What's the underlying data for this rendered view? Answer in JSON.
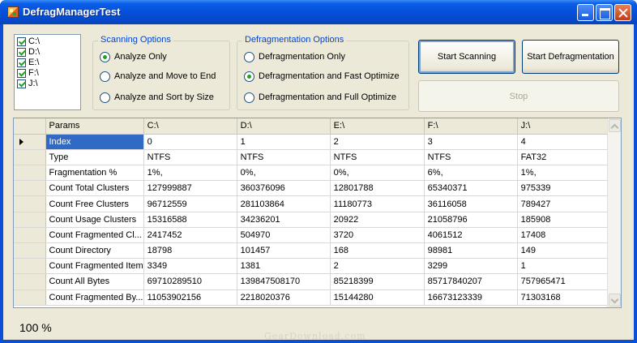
{
  "window": {
    "title": "DefragManagerTest"
  },
  "drives": [
    "C:\\",
    "D:\\",
    "E:\\",
    "F:\\",
    "J:\\"
  ],
  "scanning_options": {
    "title": "Scanning Options",
    "options": [
      "Analyze Only",
      "Analyze and Move to End",
      "Analyze and Sort by Size"
    ],
    "selected": 0
  },
  "defrag_options": {
    "title": "Defragmentation Options",
    "options": [
      "Defragmentation Only",
      "Defragmentation and Fast Optimize",
      "Defragmentation and Full Optimize"
    ],
    "selected": 1
  },
  "buttons": {
    "start_scanning": "Start Scanning",
    "start_defrag": "Start Defragmentation",
    "stop": "Stop"
  },
  "grid": {
    "headers": [
      "Params",
      "C:\\",
      "D:\\",
      "E:\\",
      "F:\\",
      "J:\\"
    ],
    "rows": [
      [
        "Index",
        "0",
        "1",
        "2",
        "3",
        "4"
      ],
      [
        "Type",
        "NTFS",
        "NTFS",
        "NTFS",
        "NTFS",
        "FAT32"
      ],
      [
        "Fragmentation %",
        "1%,",
        "0%,",
        "0%,",
        "6%,",
        "1%,"
      ],
      [
        "Count Total Clusters",
        "127999887",
        "360376096",
        "12801788",
        "65340371",
        "975339"
      ],
      [
        "Count Free Clusters",
        "96712559",
        "281103864",
        "11180773",
        "36116058",
        "789427"
      ],
      [
        "Count Usage Clusters",
        "15316588",
        "34236201",
        "20922",
        "21058796",
        "185908"
      ],
      [
        "Count Fragmented Cl...",
        "2417452",
        "504970",
        "3720",
        "4061512",
        "17408"
      ],
      [
        "Count Directory",
        "18798",
        "101457",
        "168",
        "98981",
        "149"
      ],
      [
        "Count Fragmented Item",
        "3349",
        "1381",
        "2",
        "3299",
        "1"
      ],
      [
        "Count All Bytes",
        "69710289510",
        "139847508170",
        "85218399",
        "85717840207",
        "757965471"
      ],
      [
        "Count Fragmented By...",
        "11053902156",
        "2218020376",
        "15144280",
        "16673123339",
        "71303168"
      ]
    ]
  },
  "status": {
    "progress_text": "100 %"
  },
  "watermark": "GearDownload.com"
}
